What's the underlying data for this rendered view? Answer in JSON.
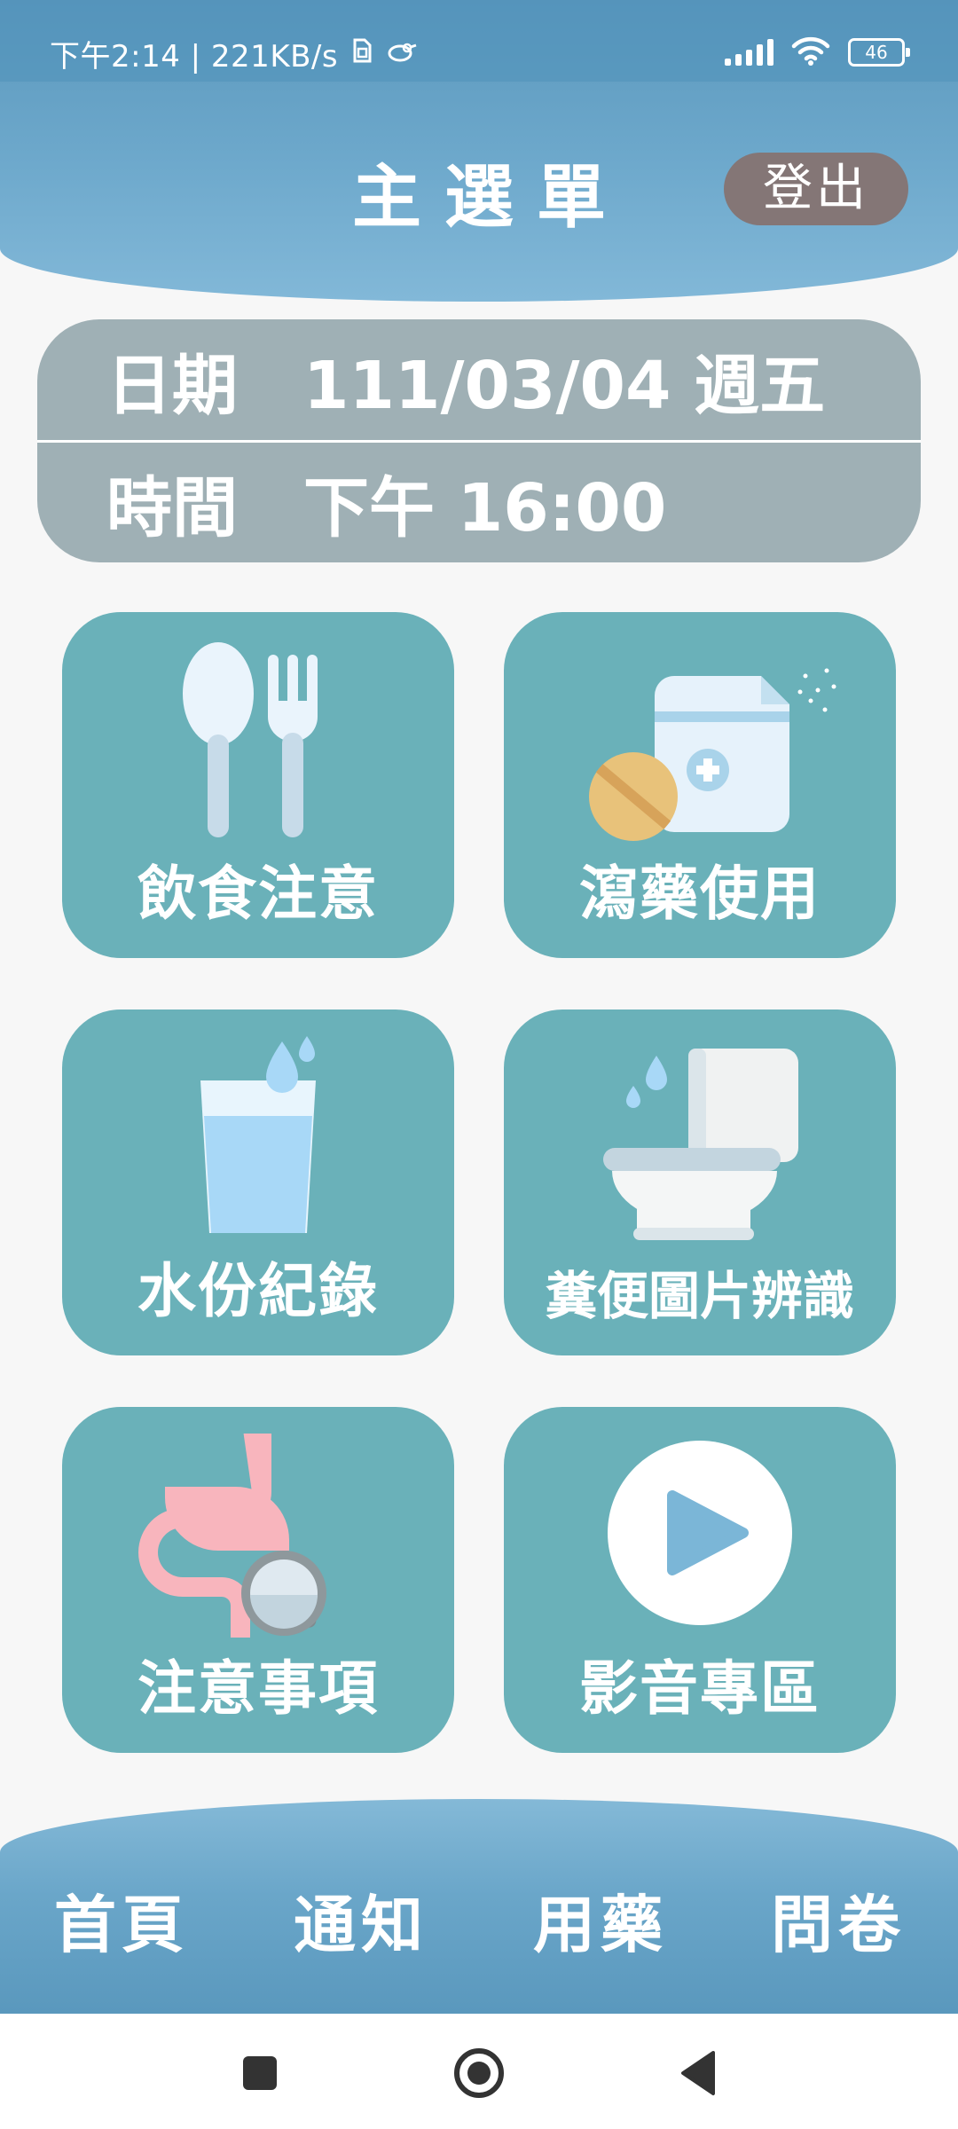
{
  "status_bar": {
    "time_speed": "下午2:14 | 221KB/s",
    "battery": "46"
  },
  "header": {
    "title": "主選單",
    "logout_label": "登出"
  },
  "datetime": {
    "date_label": "日期",
    "date_value": "111/03/04 週五",
    "time_label": "時間",
    "time_value": "下午 16:00"
  },
  "menu": {
    "diet": "飲食注意",
    "laxative": "瀉藥使用",
    "water": "水份紀錄",
    "stool": "糞便圖片辨識",
    "notes": "注意事項",
    "video": "影音專區"
  },
  "bottom_nav": {
    "home": "首頁",
    "notify": "通知",
    "medication": "用藥",
    "survey": "問卷"
  },
  "icons": {
    "tile_bg": "#6ab1b9",
    "datetime_bg": "#9fb0b5",
    "logout_bg": "#847676"
  }
}
